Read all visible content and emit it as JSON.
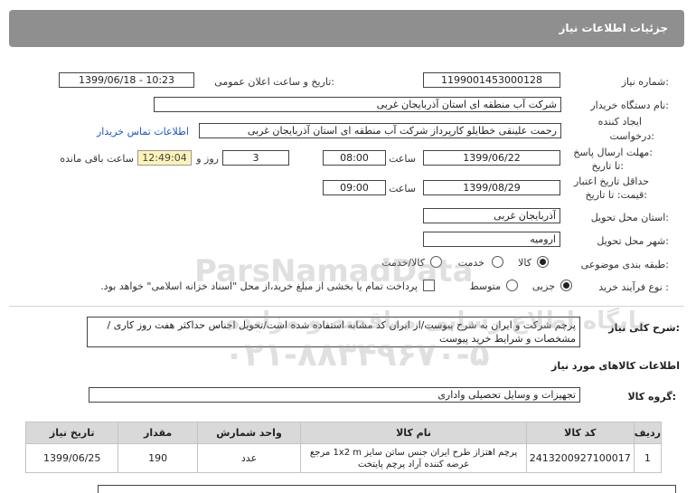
{
  "header": {
    "title": "جزئیات اطلاعات نیاز"
  },
  "fields": {
    "need_number_label": "شماره نیاز:",
    "need_number": "1199001453000128",
    "announce_label": "تاریخ و ساعت اعلان عمومی:",
    "announce_value": "1399/06/18 - 10:23",
    "buyer_label": "نام دستگاه خریدار:",
    "buyer_value": "شرکت آب منطقه ای استان آذربایجان غربی",
    "creator_label_1": "ایجاد کننده",
    "creator_label_2": "درخواست:",
    "creator_value": "رحمت علینقی خطایلو کارپرداز شرکت آب منطقه ای استان آذربایجان غربی",
    "contact_link": "اطلاعات تماس خریدار",
    "reply_label_1": "مهلت ارسال پاسخ:",
    "reply_label_2": "تا تاریخ:",
    "reply_date": "1399/06/22",
    "time_label": "ساعت",
    "reply_time": "08:00",
    "days_value": "3",
    "days_label": "روز و",
    "remaining_time": "12:49:04",
    "remaining_label": "ساعت باقی مانده",
    "validity_label_1": "حداقل تاریخ اعتبار",
    "validity_label_2": "قیمت: تا تاریخ:",
    "validity_date": "1399/08/29",
    "validity_time": "09:00",
    "province_label": "استان محل تحویل:",
    "province_value": "آذربایجان غربی",
    "city_label": "شهر محل تحویل:",
    "city_value": "ارومیه",
    "category_label": "طبقه بندی موضوعی:",
    "category_options": [
      "کالا",
      "خدمت",
      "کالا/خدمت"
    ],
    "process_label": "نوع فرآیند خرید :",
    "process_options": [
      "جزیی",
      "متوسط"
    ],
    "payment_note": "پرداخت تمام یا بخشی از مبلغ خرید،از محل \"اسناد خزانه اسلامی\" خواهد بود."
  },
  "description": {
    "label": "شرح کلی نیاز:",
    "text": "پرچم شرکت و ایران به شرح پیوست/از ایران کد مشابه استفاده شده است/تحویل اجناس حداکثر هفت روز کاری /مشخصات و شرایط خرید پیوست"
  },
  "goods_section": {
    "title": "اطلاعات کالاهای مورد نیاز",
    "group_label": "گروه کالا:",
    "group_value": "تجهیزات و وسایل تحصیلی واداری"
  },
  "table": {
    "headers": [
      "ردیف",
      "کد کالا",
      "نام کالا",
      "واحد شمارش",
      "مقدار",
      "تاریخ نیاز"
    ],
    "rows": [
      {
        "row": "1",
        "code": "2413200927100017",
        "name": "پرچم اهتزاز طرح ایران جنس ساتن سایز 1x2 m مرجع عرضه کننده آراد پرچم پایتخت",
        "unit": "عدد",
        "qty": "190",
        "date": "1399/06/25"
      }
    ]
  },
  "watermark": {
    "line1": "ParsNamadData",
    "line2": "پایگاه اطلاع رسانی مناقصه و مزایده",
    "line3": "۰۲۱-۸۸۳۴۹۶۷۰-۵"
  }
}
